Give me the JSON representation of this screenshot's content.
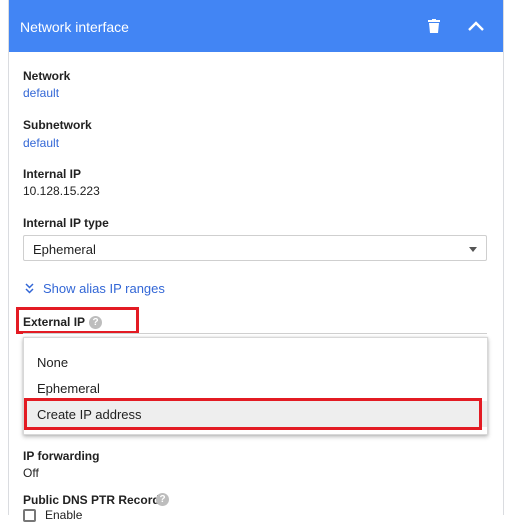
{
  "header": {
    "title": "Network interface",
    "delete_icon": "trash-icon",
    "collapse_icon": "chevron-up-icon",
    "background": "#4285f4"
  },
  "network": {
    "label": "Network",
    "value": "default"
  },
  "subnetwork": {
    "label": "Subnetwork",
    "value": "default"
  },
  "internal_ip": {
    "label": "Internal IP",
    "value": "10.128.15.223"
  },
  "internal_ip_type": {
    "label": "Internal IP type",
    "selected": "Ephemeral"
  },
  "alias": {
    "label": "Show alias IP ranges",
    "icon": "double-chevron-down-icon"
  },
  "external_ip": {
    "label": "External IP",
    "help_icon": "help-icon",
    "options": [
      "None",
      "Ephemeral",
      "Create IP address"
    ],
    "highlighted_option": "Create IP address"
  },
  "ip_forwarding": {
    "label": "IP forwarding",
    "value": "Off"
  },
  "public_dns": {
    "label": "Public DNS PTR Record",
    "checkbox_label": "Enable"
  },
  "colors": {
    "link": "#3367d6",
    "highlight": "#e31b23"
  }
}
